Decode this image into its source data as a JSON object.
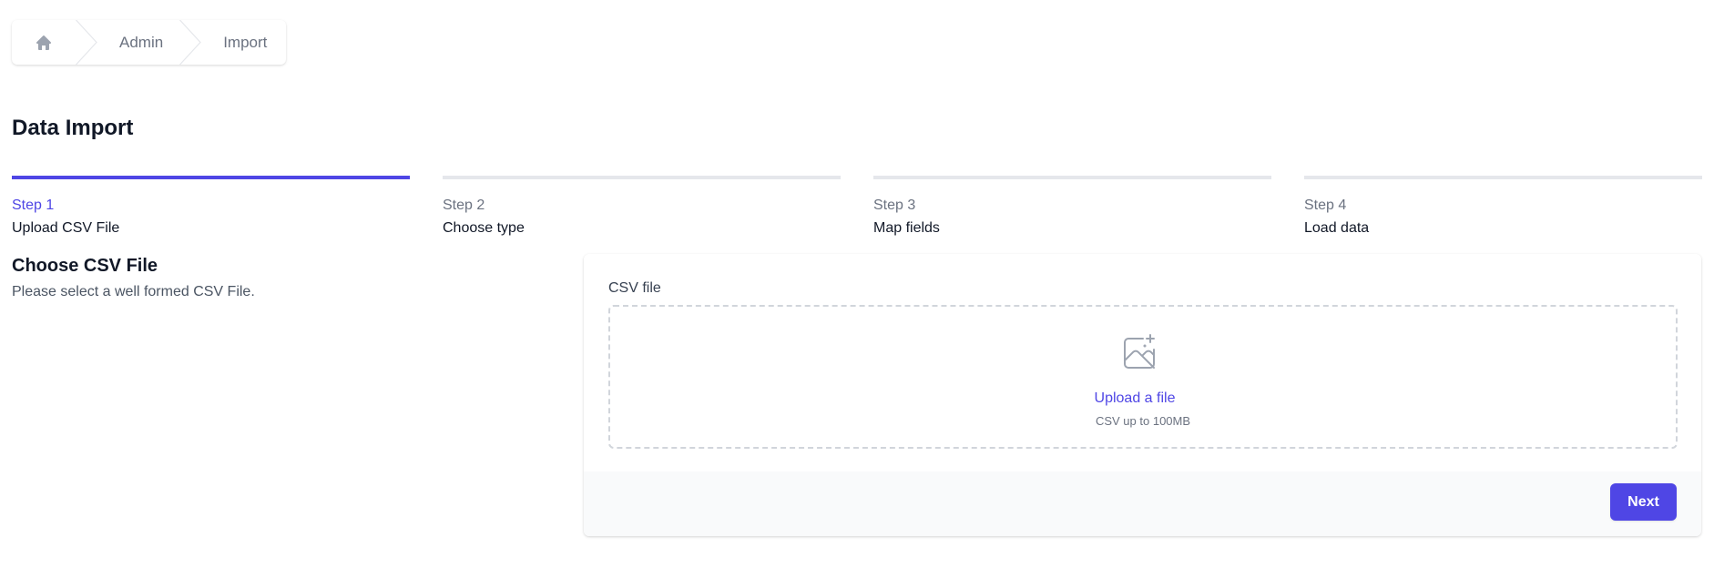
{
  "breadcrumb": {
    "home_icon": "home-icon",
    "items": [
      {
        "label": "Admin"
      },
      {
        "label": "Import"
      }
    ]
  },
  "page": {
    "title": "Data Import"
  },
  "steps": [
    {
      "number": "Step 1",
      "label": "Upload CSV File",
      "active": true
    },
    {
      "number": "Step 2",
      "label": "Choose type",
      "active": false
    },
    {
      "number": "Step 3",
      "label": "Map fields",
      "active": false
    },
    {
      "number": "Step 4",
      "label": "Load data",
      "active": false
    }
  ],
  "section": {
    "title": "Choose CSV File",
    "description": "Please select a well formed CSV File."
  },
  "upload": {
    "field_label": "CSV file",
    "icon": "image-add-icon",
    "link_text": "Upload a file",
    "hint": "CSV up to 100MB"
  },
  "footer": {
    "next_label": "Next"
  },
  "colors": {
    "accent": "#4f46e5",
    "inactive_bar": "#e5e7eb",
    "footer_bg": "#f9fafb"
  }
}
